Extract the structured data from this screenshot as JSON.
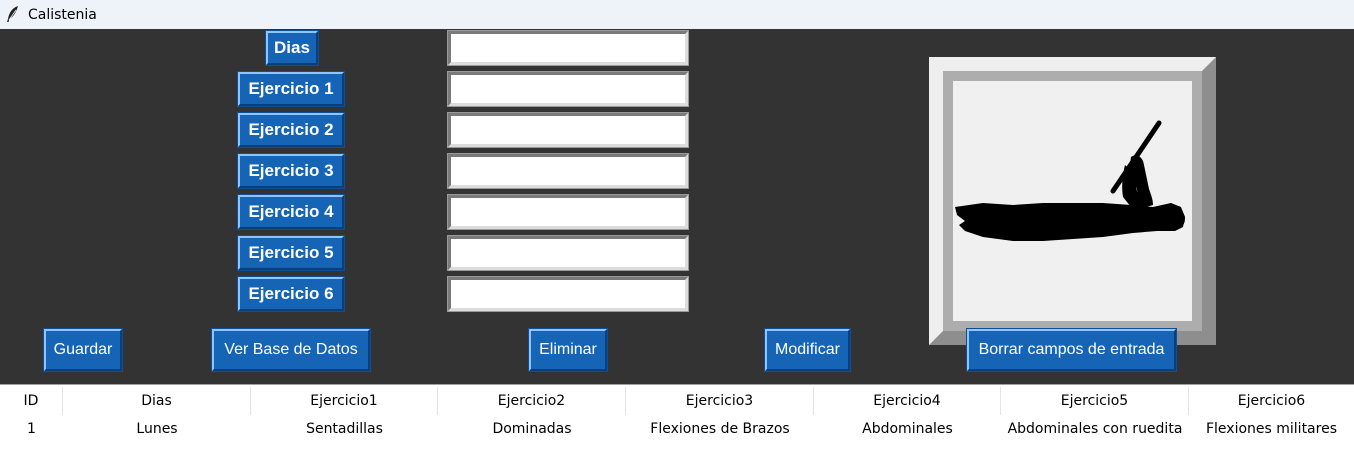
{
  "window": {
    "title": "Calistenia",
    "icon": "feather-icon"
  },
  "form": {
    "labels": [
      "Dias",
      "Ejercicio 1",
      "Ejercicio 2",
      "Ejercicio 3",
      "Ejercicio 4",
      "Ejercicio 5",
      "Ejercicio 6"
    ],
    "values": [
      "",
      "",
      "",
      "",
      "",
      "",
      ""
    ]
  },
  "image": {
    "icon": "calisthenics-front-lever-icon"
  },
  "buttons": {
    "guardar": "Guardar",
    "ver_base": "Ver Base de Datos",
    "eliminar": "Eliminar",
    "modificar": "Modificar",
    "borrar": "Borrar campos de entrada"
  },
  "table": {
    "columns": [
      "ID",
      "Dias",
      "Ejercicio1",
      "Ejercicio2",
      "Ejercicio3",
      "Ejercicio4",
      "Ejercicio5",
      "Ejercicio6"
    ],
    "rows": [
      [
        "1",
        "Lunes",
        "Sentadillas",
        "Dominadas",
        "Flexiones de Brazos",
        "Abdominales",
        "Abdominales con ruedita",
        "Flexiones militares"
      ]
    ]
  },
  "colors": {
    "panel": "#333333",
    "button": "#1564b5",
    "button_text": "#ffffff",
    "titlebar": "#eef3fa"
  }
}
